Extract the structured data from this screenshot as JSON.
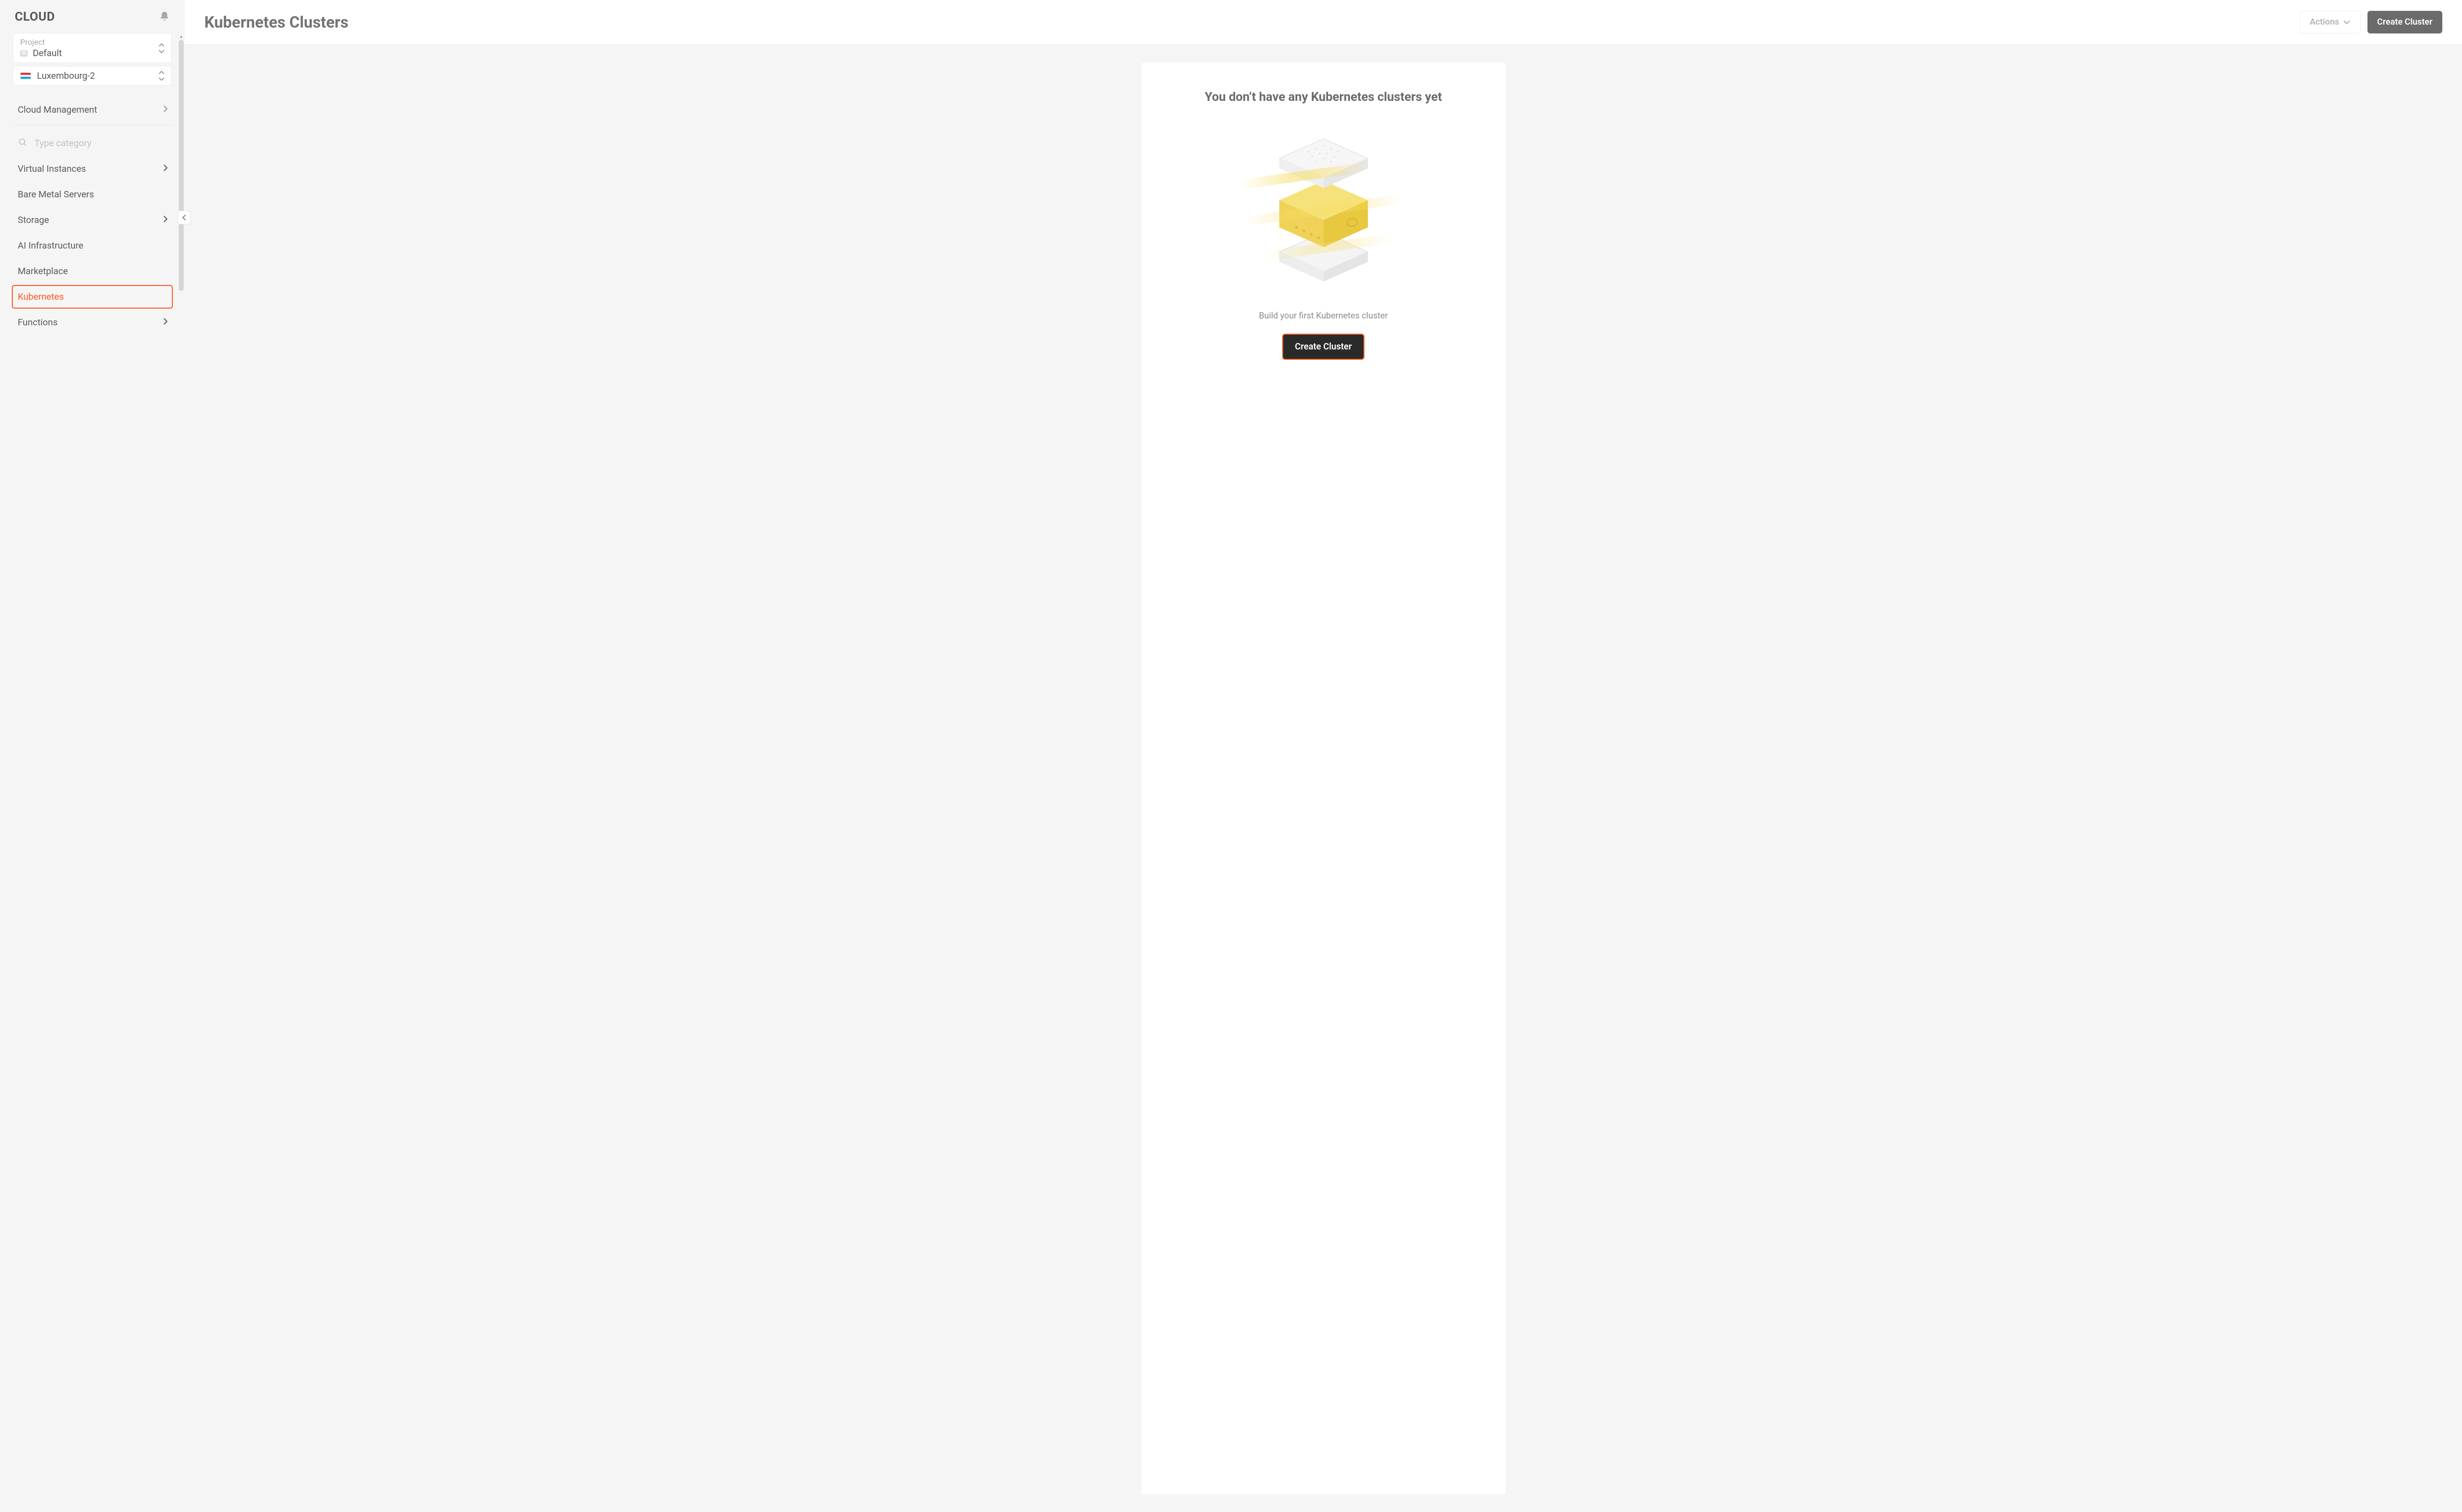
{
  "brand": "CLOUD",
  "selectors": {
    "project": {
      "label": "Project",
      "value": "Default"
    },
    "region": {
      "value": "Luxembourg-2"
    }
  },
  "section_cloud_management": "Cloud Management",
  "search_placeholder": "Type category",
  "nav": [
    {
      "label": "Virtual Instances",
      "has_chevron": true,
      "active": false
    },
    {
      "label": "Bare Metal Servers",
      "has_chevron": false,
      "active": false
    },
    {
      "label": "Storage",
      "has_chevron": true,
      "active": false
    },
    {
      "label": "AI Infrastructure",
      "has_chevron": false,
      "active": false
    },
    {
      "label": "Marketplace",
      "has_chevron": false,
      "active": false
    },
    {
      "label": "Kubernetes",
      "has_chevron": false,
      "active": true
    },
    {
      "label": "Functions",
      "has_chevron": true,
      "active": false
    }
  ],
  "page": {
    "title": "Kubernetes Clusters",
    "actions_label": "Actions",
    "create_button": "Create Cluster"
  },
  "empty_state": {
    "title": "You don’t have any Kubernetes clusters yet",
    "caption": "Build your first Kubernetes cluster",
    "cta": "Create Cluster"
  }
}
